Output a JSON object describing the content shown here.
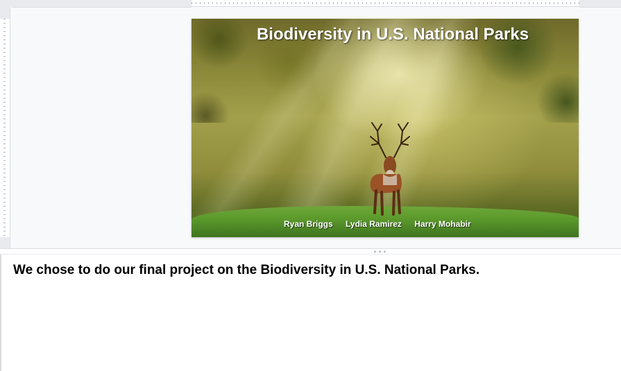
{
  "slide": {
    "title": "Biodiversity in U.S. National Parks",
    "authors": [
      "Ryan Briggs",
      "Lydia Ramirez",
      "Harry Mohabir"
    ],
    "image_subject": "stag-in-sunlit-forest"
  },
  "speaker_notes": {
    "text": "We chose to do our final project on the Biodiversity in U.S. National Parks."
  },
  "colors": {
    "editor_background": "#f8f9fa",
    "ruler_background": "#e8eaed",
    "title_text": "#ffffff",
    "notes_text": "#000000"
  }
}
